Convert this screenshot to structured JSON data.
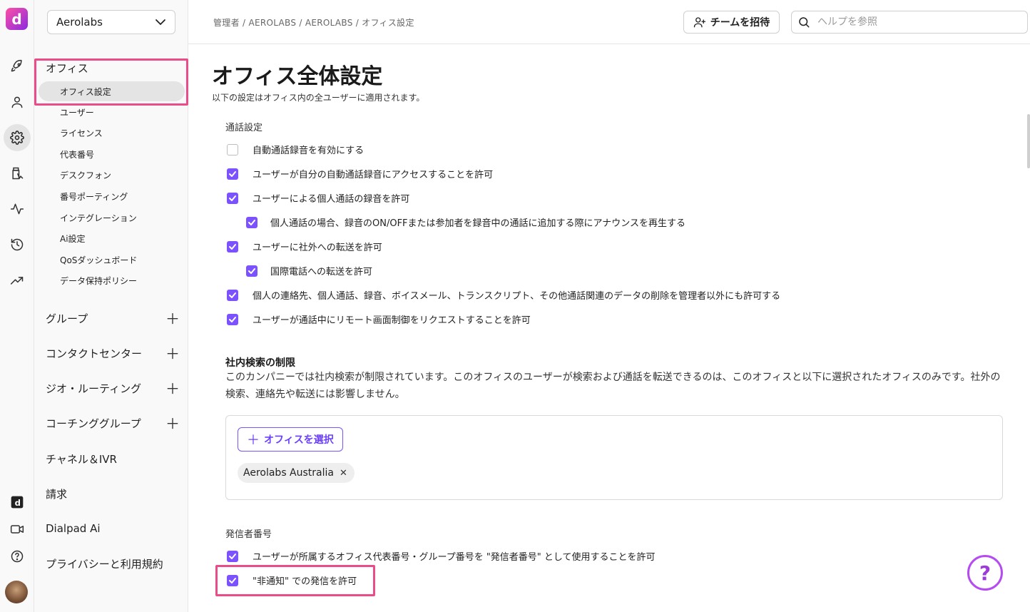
{
  "rail": {
    "logo_letter": "d",
    "icons": [
      "rocket-icon",
      "user-icon",
      "gear-icon",
      "contact-center-icon",
      "activity-icon",
      "history-icon",
      "trending-icon",
      "dialpad-app-icon",
      "video-icon",
      "help-circle-icon"
    ]
  },
  "sidebar": {
    "org_name": "Aerolabs",
    "office_heading": "オフィス",
    "office_items": [
      "オフィス設定",
      "ユーザー",
      "ライセンス",
      "代表番号",
      "デスクフォン",
      "番号ポーティング",
      "インテグレーション",
      "Ai設定",
      "QoSダッシュボード",
      "データ保持ポリシー"
    ],
    "groups": [
      {
        "label": "グループ",
        "expandable": true
      },
      {
        "label": "コンタクトセンター",
        "expandable": true
      },
      {
        "label": "ジオ・ルーティング",
        "expandable": true
      },
      {
        "label": "コーチンググループ",
        "expandable": true
      },
      {
        "label": "チャネル＆IVR",
        "expandable": false
      },
      {
        "label": "請求",
        "expandable": false
      },
      {
        "label": "Dialpad Ai",
        "expandable": false
      },
      {
        "label": "プライバシーと利用規約",
        "expandable": false
      }
    ]
  },
  "topbar": {
    "breadcrumb": "管理者 / AEROLABS / AEROLABS / オフィス設定",
    "invite_label": "チームを招待",
    "search_placeholder": "ヘルプを参照"
  },
  "main": {
    "title": "オフィス全体設定",
    "subtitle": "以下の設定はオフィス内の全ユーザーに適用されます。",
    "call_settings_label": "通話設定",
    "call_settings": [
      {
        "label": "自動通話録音を有効にする",
        "checked": false,
        "indent": false
      },
      {
        "label": "ユーザーが自分の自動通話録音にアクセスすることを許可",
        "checked": true,
        "indent": false
      },
      {
        "label": "ユーザーによる個人通話の録音を許可",
        "checked": true,
        "indent": false
      },
      {
        "label": "個人通話の場合、録音のON/OFFまたは参加者を録音中の通話に追加する際にアナウンスを再生する",
        "checked": true,
        "indent": true
      },
      {
        "label": "ユーザーに社外への転送を許可",
        "checked": true,
        "indent": false
      },
      {
        "label": "国際電話への転送を許可",
        "checked": true,
        "indent": true
      },
      {
        "label": "個人の連絡先、個人通話、録音、ボイスメール、トランスクリプト、その他通話関連のデータの削除を管理者以外にも許可する",
        "checked": true,
        "indent": false
      },
      {
        "label": "ユーザーが通話中にリモート画面制御をリクエストすることを許可",
        "checked": true,
        "indent": false
      }
    ],
    "search_restriction_heading": "社内検索の制限",
    "search_restriction_text": "このカンパニーでは社内検索が制限されています。このオフィスのユーザーが検索および通話を転送できるのは、このオフィスと以下に選択されたオフィスのみです。社外の検索、連絡先や転送には影響しません。",
    "select_office_label": "オフィスを選択",
    "selected_office_chip": "Aerolabs Australia",
    "caller_id_label": "発信者番号",
    "caller_id_settings": [
      {
        "label": "ユーザーが所属するオフィス代表番号・グループ番号を \"発信者番号\" として使用することを許可",
        "checked": true
      },
      {
        "label": "\"非通知\" での発信を許可",
        "checked": true
      }
    ],
    "help_glyph": "?"
  },
  "colors": {
    "accent": "#7c52ff",
    "highlight": "#ea4c89"
  }
}
